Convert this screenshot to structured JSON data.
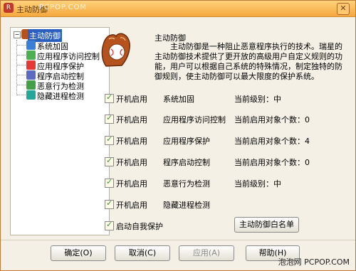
{
  "window": {
    "title": "主动防御",
    "watermark": "PCPOP.COM",
    "close_glyph": "✕",
    "app_icon_glyph": "R"
  },
  "sidebar": {
    "root": "主动防御",
    "items": [
      {
        "label": "系统加固",
        "icon": "shield-icon",
        "color": "#3a7fd5"
      },
      {
        "label": "应用程序访问控制",
        "icon": "app-access-icon",
        "color": "#4caf50"
      },
      {
        "label": "应用程序保护",
        "icon": "app-protect-icon",
        "color": "#e53935"
      },
      {
        "label": "程序启动控制",
        "icon": "startup-icon",
        "color": "#5c6bc0"
      },
      {
        "label": "恶意行为检测",
        "icon": "malware-icon",
        "color": "#43a047"
      },
      {
        "label": "隐藏进程检测",
        "icon": "hidden-process-icon",
        "color": "#26a69a"
      }
    ]
  },
  "content": {
    "heading": "主动防御",
    "description": "主动防御是一种阻止恶意程序执行的技术。瑞星的主动防御技术提供了更开放的高级用户自定义规则的功能，用户可以根据自己系统的特殊情况，制定独特的防御规则，使主动防御可以最大限度的保护系统。",
    "rows": [
      {
        "checkbox": "开机启用",
        "module": "系统加固",
        "status": "当前级别：中"
      },
      {
        "checkbox": "开机启用",
        "module": "应用程序访问控制",
        "status": "当前启用对象个数：0"
      },
      {
        "checkbox": "开机启用",
        "module": "应用程序保护",
        "status": "当前启用对象个数：4"
      },
      {
        "checkbox": "开机启用",
        "module": "程序启动控制",
        "status": "当前启用对象个数：0"
      },
      {
        "checkbox": "开机启用",
        "module": "恶意行为检测",
        "status": "当前级别：中"
      },
      {
        "checkbox": "开机启用",
        "module": "隐藏进程检测",
        "status": ""
      }
    ],
    "self_protect": "启动自我保护",
    "whitelist_button": "主动防御白名单"
  },
  "footer": {
    "ok": "确定(O)",
    "cancel": "取消(C)",
    "apply": "应用(A)",
    "help": "帮助(H)",
    "watermark": "泡泡网 PCPOP.COM"
  },
  "colors": {
    "title_bar": "#f5a83e",
    "selection": "#2a5fbf",
    "check": "#2c9a2c"
  }
}
